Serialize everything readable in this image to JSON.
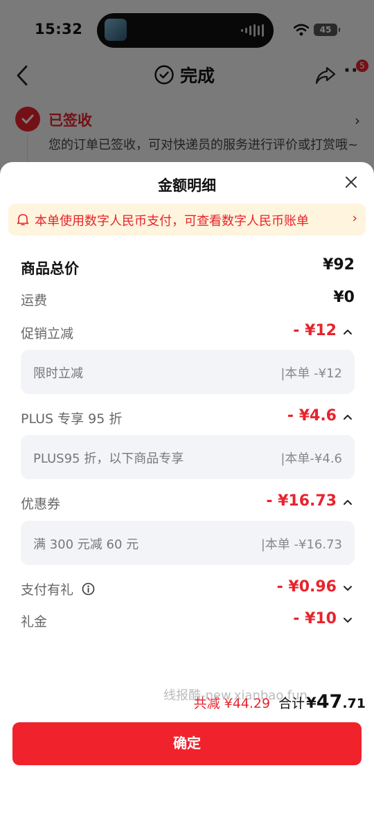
{
  "status_bar": {
    "time": "15:32",
    "battery": "45"
  },
  "nav": {
    "title": "完成",
    "badge": "5",
    "more": "···"
  },
  "order_status": {
    "title": "已签收",
    "desc": "您的订单已签收，可对快递员的服务进行评价或打赏哦~"
  },
  "sheet": {
    "title": "金额明细",
    "notice": "本单使用数字人民币支付，可查看数字人民币账单",
    "rows": {
      "goods_total": {
        "label": "商品总价",
        "value": "¥92"
      },
      "shipping": {
        "label": "运费",
        "value": "¥0"
      },
      "promo": {
        "label": "促销立减",
        "value": "- ¥12",
        "detail_left": "限时立减",
        "detail_right": "|本单 -¥12"
      },
      "plus": {
        "label": "PLUS 专享 95 折",
        "value": "- ¥4.6",
        "detail_left": "PLUS95 折，以下商品专享",
        "detail_right": "|本单-¥4.6"
      },
      "coupon": {
        "label": "优惠券",
        "value": "- ¥16.73",
        "detail_left": "满 300 元减 60 元",
        "detail_right": "|本单 -¥16.73"
      },
      "pay_gift": {
        "label": "支付有礼",
        "value": "- ¥0.96"
      },
      "gift_cash": {
        "label": "礼金",
        "value": "- ¥10"
      }
    },
    "watermark": "线报酷-new.xianbao.fun",
    "total": {
      "discount": "共减 ¥44.29",
      "label": "合计",
      "yen": "¥",
      "int": "47",
      "dec": ".71"
    },
    "confirm_label": "确定"
  },
  "colors": {
    "accent": "#e8232c",
    "notice_bg": "#fff4dd",
    "detail_bg": "#f3f4f7"
  },
  "icons": [
    "back-icon",
    "check-circle-icon",
    "share-icon",
    "more-icon",
    "close-icon",
    "bell-icon",
    "chevron-right-icon",
    "chevron-up-icon",
    "chevron-down-icon",
    "info-icon"
  ]
}
